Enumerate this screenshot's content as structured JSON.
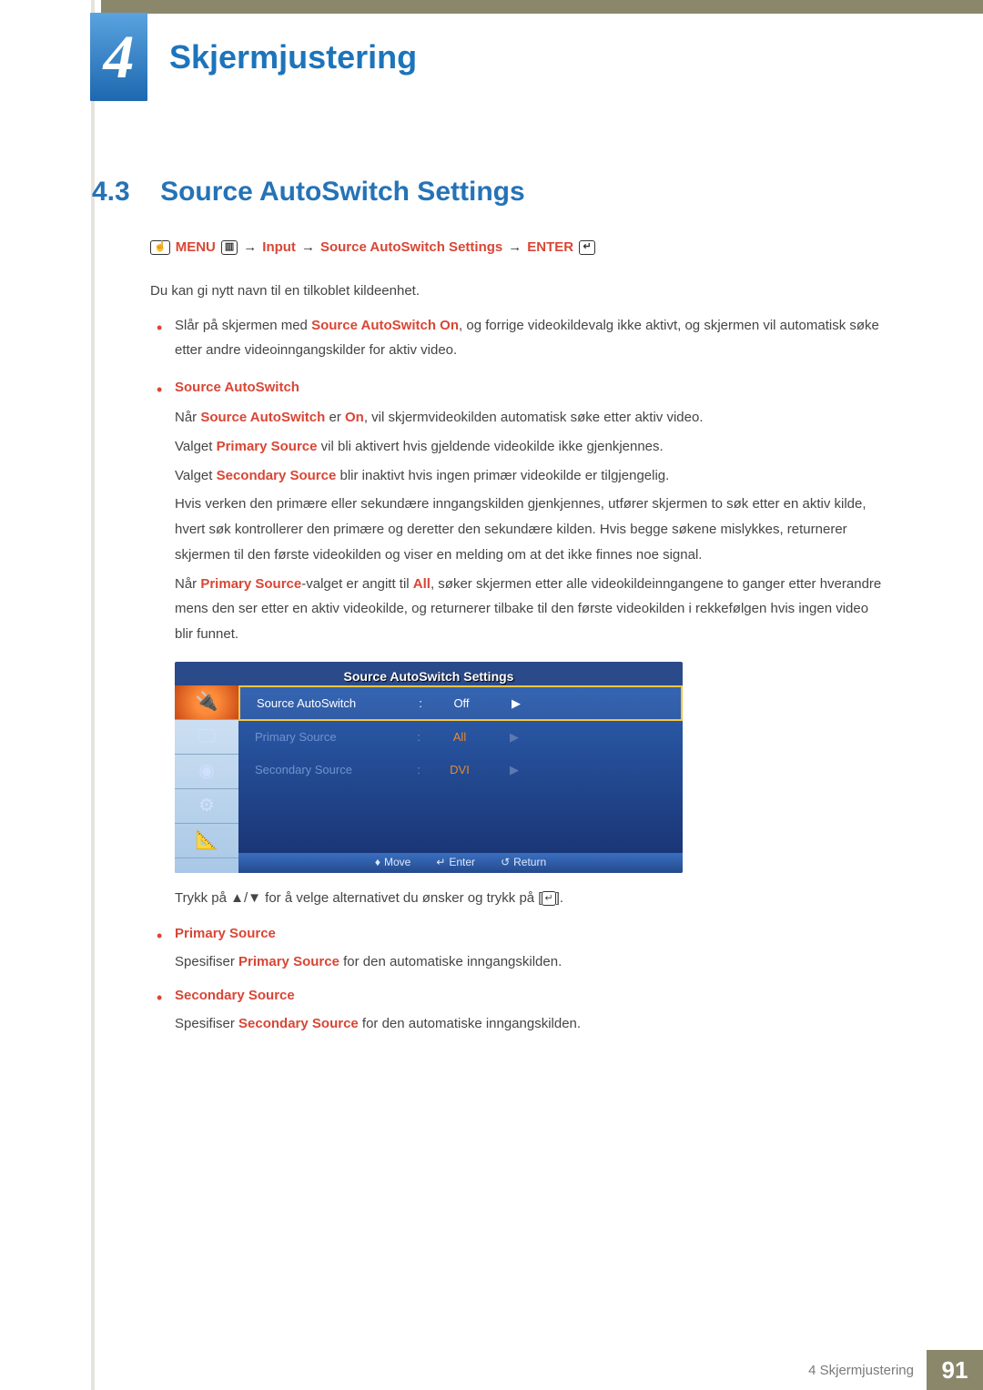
{
  "chapter": {
    "number": "4",
    "title": "Skjermjustering"
  },
  "section": {
    "number": "4.3",
    "title": "Source AutoSwitch Settings"
  },
  "breadcrumb": {
    "menu": "MENU",
    "input": "Input",
    "setting": "Source AutoSwitch Settings",
    "enter": "ENTER"
  },
  "intro": "Du kan gi nytt navn til en tilkoblet kildeenhet.",
  "first_bullet": {
    "pre": "Slår på skjermen med ",
    "bold": "Source AutoSwitch On",
    "post": ", og forrige videokildevalg ikke aktivt, og skjermen vil automatisk søke etter andre videoinngangskilder for aktiv video."
  },
  "sas_heading": "Source AutoSwitch",
  "sas_p1": {
    "pre": "Når ",
    "b1": "Source AutoSwitch",
    "mid": " er ",
    "b2": "On",
    "post": ", vil skjermvideokilden automatisk søke etter aktiv video."
  },
  "sas_p2": {
    "pre": "Valget ",
    "b": "Primary Source",
    "post": " vil bli aktivert hvis gjeldende videokilde ikke gjenkjennes."
  },
  "sas_p3": {
    "pre": "Valget ",
    "b": "Secondary Source",
    "post": " blir inaktivt hvis ingen primær videokilde er tilgjengelig."
  },
  "sas_p4": "Hvis verken den primære eller sekundære inngangskilden gjenkjennes, utfører skjermen to søk etter en aktiv kilde, hvert søk kontrollerer den primære og deretter den sekundære kilden. Hvis begge søkene mislykkes, returnerer skjermen til den første videokilden og viser en melding om at det ikke finnes noe signal.",
  "sas_p5": {
    "pre": "Når ",
    "b1": "Primary Source",
    "mid1": "-valget er angitt til ",
    "b2": "All",
    "post": ", søker skjermen etter alle videokildeinngangene to ganger etter hverandre mens den ser etter en aktiv videokilde, og returnerer tilbake til den første videokilden i rekkefølgen hvis ingen video blir funnet."
  },
  "osd": {
    "title": "Source AutoSwitch Settings",
    "rows": [
      {
        "label": "Source AutoSwitch",
        "value": "Off",
        "selected": true
      },
      {
        "label": "Primary Source",
        "value": "All",
        "selected": false
      },
      {
        "label": "Secondary Source",
        "value": "DVI",
        "selected": false
      }
    ],
    "footer": {
      "move": "Move",
      "enter": "Enter",
      "return": "Return"
    }
  },
  "after_osd": {
    "pre": "Trykk på ▲/▼ for å velge alternativet du ønsker og trykk på [",
    "post": "]."
  },
  "primary": {
    "heading": "Primary Source",
    "pre": "Spesifiser ",
    "b": "Primary Source",
    "post": " for den automatiske inngangskilden."
  },
  "secondary": {
    "heading": "Secondary Source",
    "pre": "Spesifiser ",
    "b": "Secondary Source",
    "post": " for den automatiske inngangskilden."
  },
  "footer": {
    "chapter": "4 Skjermjustering",
    "page": "91"
  }
}
